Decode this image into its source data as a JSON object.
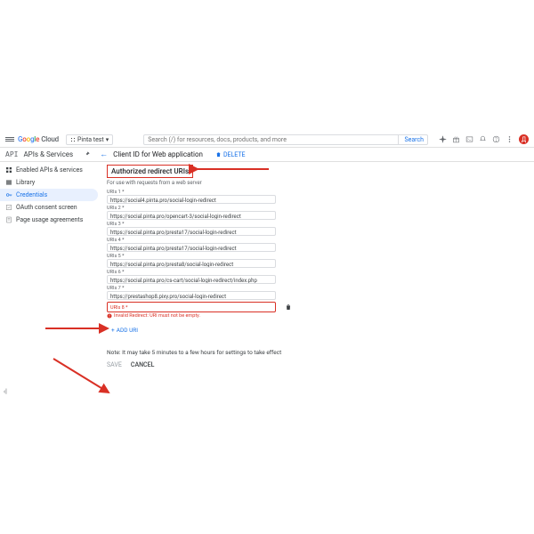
{
  "header": {
    "brand_cloud": "Cloud",
    "project": "Pinta test",
    "search_placeholder": "Search (/) for resources, docs, products, and more",
    "search_button": "Search",
    "avatar_initial": "Д"
  },
  "section": {
    "api_logo": "API",
    "title": "APIs & Services",
    "page_title": "Client ID for Web application",
    "delete": "DELETE"
  },
  "sidebar": {
    "items": [
      {
        "label": "Enabled APIs & services"
      },
      {
        "label": "Library"
      },
      {
        "label": "Credentials"
      },
      {
        "label": "OAuth consent screen"
      },
      {
        "label": "Page usage agreements"
      }
    ],
    "collapse": "‹|"
  },
  "main": {
    "heading": "Authorized redirect URIs",
    "subnote": "For use with requests from a web server",
    "uris": [
      {
        "label": "URIs 1 *",
        "value": "https://social4.pinta.pro/social-login-redirect"
      },
      {
        "label": "URIs 2 *",
        "value": "https://social.pinta.pro/opencart-3/social-login-redirect"
      },
      {
        "label": "URIs 3 *",
        "value": "https://social.pinta.pro/presta17/social-login-redirect"
      },
      {
        "label": "URIs 4 *",
        "value": "https://social.pinta.pro/presta17/social-login-redirect"
      },
      {
        "label": "URIs 5 *",
        "value": "https://social.pinta.pro/presta8/social-login-redirect"
      },
      {
        "label": "URIs 6 *",
        "value": "https://social.pinta.pro/cs-cart/social-login-redirect/index.php"
      },
      {
        "label": "URIs 7 *",
        "value": "https://prestashop8.pixy.pro/social-login-redirect"
      }
    ],
    "err_label": "URIs 8 *",
    "err_value": "",
    "err_msg": "Invalid Redirect: URI must not be empty.",
    "add_uri": "ADD URI",
    "note": "Note: It may take 5 minutes to a few hours for settings to take effect",
    "save": "SAVE",
    "cancel": "CANCEL"
  }
}
